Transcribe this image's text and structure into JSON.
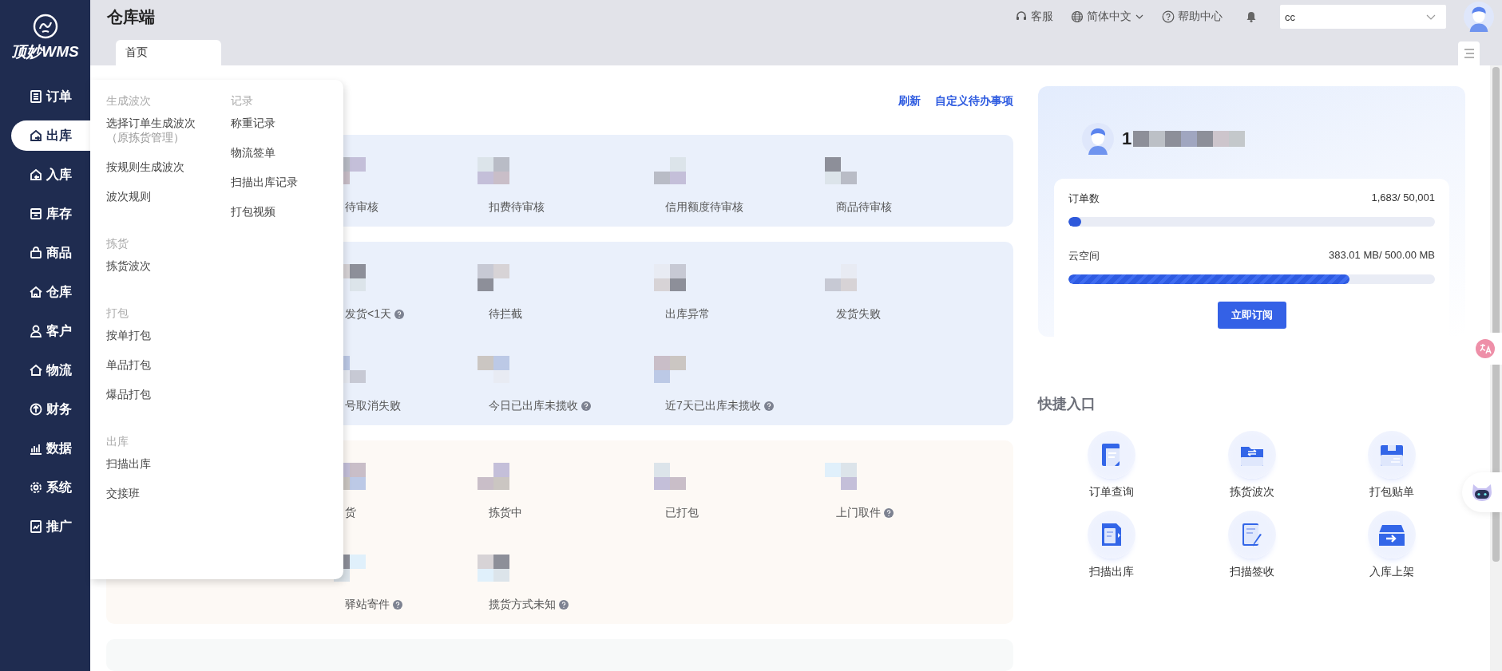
{
  "sidebar": {
    "logo_text": "顶妙WMS",
    "items": [
      {
        "label": "订单",
        "selected": false
      },
      {
        "label": "出库",
        "selected": true
      },
      {
        "label": "入库",
        "selected": false
      },
      {
        "label": "库存",
        "selected": false
      },
      {
        "label": "商品",
        "selected": false
      },
      {
        "label": "仓库",
        "selected": false
      },
      {
        "label": "客户",
        "selected": false
      },
      {
        "label": "物流",
        "selected": false
      },
      {
        "label": "财务",
        "selected": false
      },
      {
        "label": "数据",
        "selected": false
      },
      {
        "label": "系统",
        "selected": false
      },
      {
        "label": "推广",
        "selected": false
      }
    ]
  },
  "header": {
    "title": "仓库端",
    "service": "客服",
    "language": "简体中文",
    "help": "帮助中心",
    "select": {
      "value": "cc"
    }
  },
  "tabs": [
    {
      "label": "首页",
      "selected": true
    }
  ],
  "dropdown_menu": {
    "columns": [
      [
        {
          "heading": "生成波次",
          "items": [
            {
              "label": "选择订单生成波次",
              "note": "（原拣货管理）"
            },
            {
              "label": "按规则生成波次"
            },
            {
              "label": "波次规则"
            }
          ]
        },
        {
          "heading": "拣货",
          "items": [
            {
              "label": "拣货波次"
            }
          ]
        },
        {
          "heading": "打包",
          "items": [
            {
              "label": "按单打包"
            },
            {
              "label": "单品打包"
            },
            {
              "label": "爆品打包"
            }
          ]
        },
        {
          "heading": "出库",
          "items": [
            {
              "label": "扫描出库"
            },
            {
              "label": "交接班"
            }
          ]
        }
      ],
      [
        {
          "heading": "记录",
          "items": [
            {
              "label": "称重记录"
            },
            {
              "label": "物流签单"
            },
            {
              "label": "扫描出库记录"
            },
            {
              "label": "打包视频"
            }
          ]
        }
      ]
    ]
  },
  "todo": {
    "links": [
      "刷新",
      "自定义待办事项"
    ],
    "cards": [
      {
        "color": "#eaf0fb",
        "rows": [
          [
            {
              "label": "待审核",
              "help": false
            },
            {
              "label": "扣费待审核",
              "help": false
            },
            {
              "label": "信用额度待审核",
              "help": false
            },
            {
              "label": "商品待审核",
              "help": false
            }
          ]
        ]
      },
      {
        "color": "#eaf0fb",
        "rows": [
          [
            {
              "label": "发货<1天",
              "help": true
            },
            {
              "label": "待拦截",
              "help": false
            },
            {
              "label": "出库异常",
              "help": false
            },
            {
              "label": "发货失败",
              "help": false
            }
          ],
          [
            {
              "label": "号取消失败",
              "help": false
            },
            {
              "label": "今日已出库未揽收",
              "help": true
            },
            {
              "label": "近7天已出库未揽收",
              "help": true
            }
          ]
        ]
      },
      {
        "color": "#fdf9f5",
        "rows": [
          [
            {
              "label": "货",
              "help": false
            },
            {
              "label": "拣货中",
              "help": false
            },
            {
              "label": "已打包",
              "help": false
            },
            {
              "label": "上门取件",
              "help": true
            }
          ],
          [
            {
              "label": "驿站寄件",
              "help": true
            },
            {
              "label": "揽货方式未知",
              "help": true
            }
          ]
        ]
      },
      {
        "color": "#f7f9f9"
      }
    ]
  },
  "account": {
    "name": "1",
    "usage": [
      {
        "label": "订单数",
        "reading": "1,683/ 50,001",
        "level": 0.034
      },
      {
        "label": "云空间",
        "reading": "383.01 MB/ 500.00 MB",
        "level": 0.766
      }
    ],
    "button": "立即订阅"
  },
  "shortcuts": {
    "title": "快捷入口",
    "items": [
      {
        "label": "订单查询"
      },
      {
        "label": "拣货波次"
      },
      {
        "label": "打包贴单"
      },
      {
        "label": "扫描出库"
      },
      {
        "label": "扫描签收"
      },
      {
        "label": "入库上架"
      }
    ]
  }
}
